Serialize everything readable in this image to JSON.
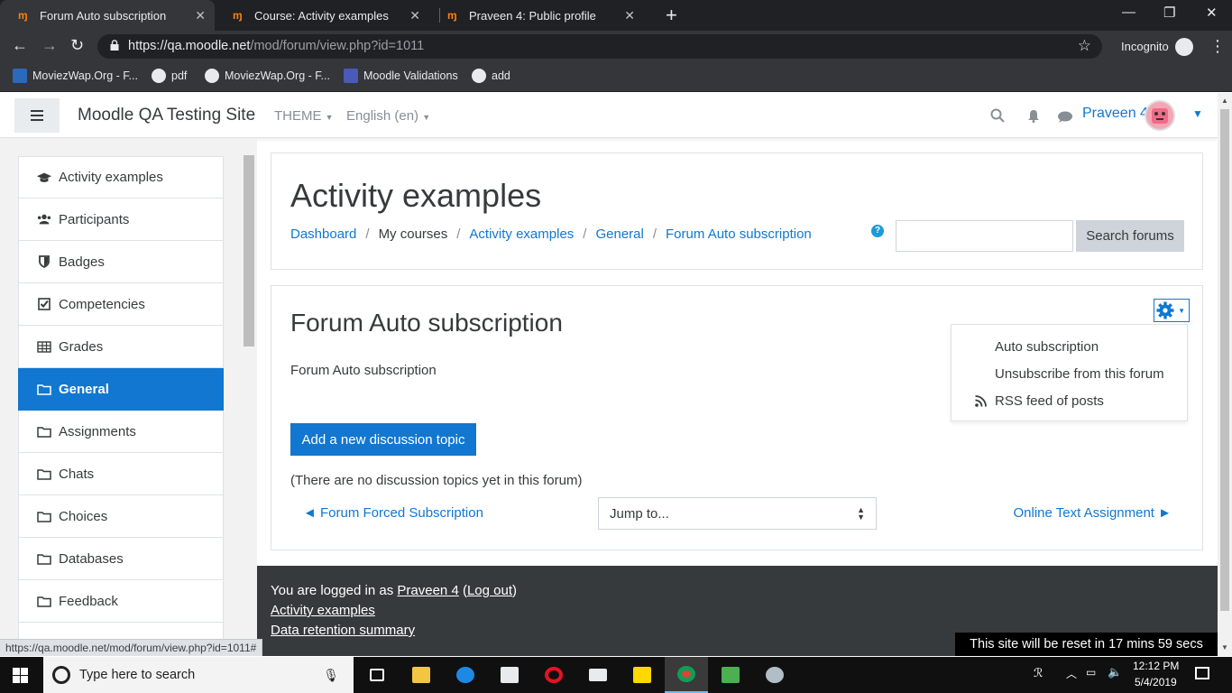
{
  "browser": {
    "tabs": [
      {
        "title": "Forum Auto subscription",
        "active": true
      },
      {
        "title": "Course: Activity examples",
        "active": false
      },
      {
        "title": "Praveen 4: Public profile",
        "active": false
      }
    ],
    "url_host": "https://qa.moodle.net",
    "url_path": "/mod/forum/view.php?id=1011",
    "incognito_label": "Incognito",
    "bookmarks": [
      {
        "label": "MoviezWap.Org - F...",
        "icon": "moviezwap-icon"
      },
      {
        "label": "pdf",
        "icon": "pdf-icon"
      },
      {
        "label": "MoviezWap.Org - F...",
        "icon": "globe-icon"
      },
      {
        "label": "Moodle Validations",
        "icon": "moodle-icon"
      },
      {
        "label": "add",
        "icon": "globe-icon"
      }
    ],
    "status_url": "https://qa.moodle.net/mod/forum/view.php?id=1011#"
  },
  "navbar": {
    "site_name": "Moodle QA Testing Site",
    "theme_label": "THEME",
    "language_label": "English (en)",
    "user_name": "Praveen 4"
  },
  "drawer": {
    "items": [
      {
        "label": "Activity examples",
        "icon": "graduation-cap-icon"
      },
      {
        "label": "Participants",
        "icon": "users-icon"
      },
      {
        "label": "Badges",
        "icon": "shield-icon"
      },
      {
        "label": "Competencies",
        "icon": "checkbox-icon"
      },
      {
        "label": "Grades",
        "icon": "table-icon"
      },
      {
        "label": "General",
        "icon": "folder-icon",
        "active": true
      },
      {
        "label": "Assignments",
        "icon": "folder-icon"
      },
      {
        "label": "Chats",
        "icon": "folder-icon"
      },
      {
        "label": "Choices",
        "icon": "folder-icon"
      },
      {
        "label": "Databases",
        "icon": "folder-icon"
      },
      {
        "label": "Feedback",
        "icon": "folder-icon"
      }
    ]
  },
  "header": {
    "title": "Activity examples",
    "breadcrumb": [
      {
        "label": "Dashboard",
        "link": true
      },
      {
        "label": "My courses",
        "link": false
      },
      {
        "label": "Activity examples",
        "link": true
      },
      {
        "label": "General",
        "link": true
      },
      {
        "label": "Forum Auto subscription",
        "link": true
      }
    ],
    "search_placeholder": "",
    "search_button": "Search forums"
  },
  "forum": {
    "title": "Forum Auto subscription",
    "intro": "Forum Auto subscription",
    "add_topic_button": "Add a new discussion topic",
    "no_topics_text": "(There are no discussion topics yet in this forum)",
    "prev_activity": "◄ Forum Forced Subscription",
    "jump_to": "Jump to...",
    "next_activity": "Online Text Assignment ►",
    "actions_menu": [
      "Auto subscription",
      "Unsubscribe from this forum",
      "RSS feed of posts"
    ]
  },
  "footer": {
    "logged_in_prefix": "You are logged in as",
    "user_link": "Praveen 4",
    "logout_link": "Log out",
    "course_link": "Activity examples",
    "data_retention_link": "Data retention summary",
    "reset_banner": "This site will be reset in 17 mins 59 secs"
  },
  "taskbar": {
    "search_placeholder": "Type here to search",
    "time": "12:12 PM",
    "date": "5/4/2019"
  },
  "colors": {
    "accent": "#1177d1",
    "footer_bg": "#373a3c",
    "moodle_orange": "#f98012"
  }
}
